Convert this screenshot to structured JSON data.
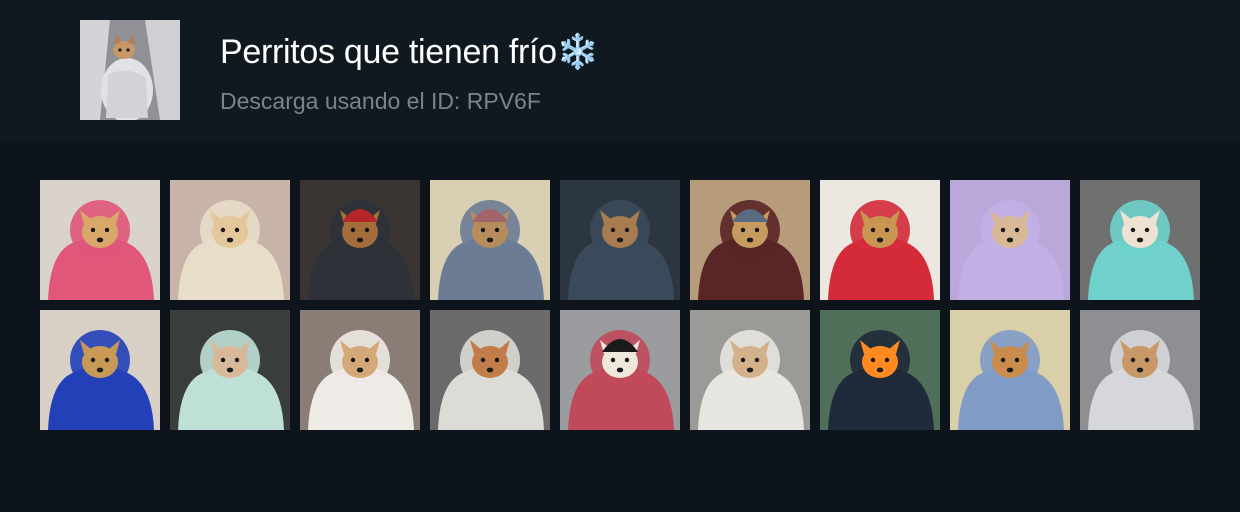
{
  "pack": {
    "title": "Perritos que tienen frío❄️",
    "subtitle": "Descarga usando el ID: RPV6F",
    "thumbnail": {
      "subject": "small dog wrapped in white blanket",
      "bg": "#8f9196",
      "blanket": "#d7d8dc",
      "dog": "#c99868"
    }
  },
  "stickers": [
    {
      "name": "sticker-puppy-sleeping-pink-blanket",
      "bg": "#d9d3cc",
      "blanket": "#e0577a",
      "dog": "#d9a76a",
      "hat": null
    },
    {
      "name": "sticker-puppy-cream-hoodie",
      "bg": "#c8b3a8",
      "blanket": "#e8ddc8",
      "dog": "#e4c79b",
      "hat": null
    },
    {
      "name": "sticker-dog-red-beanie-sunglasses",
      "bg": "#3a3532",
      "blanket": "#2e3238",
      "dog": "#a36e3c",
      "hat": "#b5262a"
    },
    {
      "name": "sticker-dog-blue-hoodie-couch",
      "bg": "#d9cfb2",
      "blanket": "#6d7c95",
      "dog": "#b58d5c",
      "hat": "#a4656a"
    },
    {
      "name": "sticker-chihuahua-dark-hood-closeup",
      "bg": "#2c3640",
      "blanket": "#3a4a5a",
      "dog": "#a87b50",
      "hat": null
    },
    {
      "name": "sticker-dog-maroon-sweater-beanie",
      "bg": "#b79c7c",
      "blanket": "#5a2525",
      "dog": "#c79a60",
      "hat": "#5a6a80"
    },
    {
      "name": "sticker-dog-red-puffer-jacket",
      "bg": "#ece8e0",
      "blanket": "#d42a3a",
      "dog": "#c89552",
      "hat": null
    },
    {
      "name": "sticker-chihuahua-lilac-blanket",
      "bg": "#b9a8d9",
      "blanket": "#c2afe4",
      "dog": "#d8b896",
      "hat": null
    },
    {
      "name": "sticker-chihuahua-teal-blanket",
      "bg": "#6f7070",
      "blanket": "#6fd0cc",
      "dog": "#efe2d2",
      "hat": null
    },
    {
      "name": "sticker-dog-blue-hoodie",
      "bg": "#d8cfc6",
      "blanket": "#2440b8",
      "dog": "#c99a55",
      "hat": null
    },
    {
      "name": "sticker-dog-mint-blanket-car",
      "bg": "#3a3d3e",
      "blanket": "#bfe0d6",
      "dog": "#d7b99a",
      "hat": null
    },
    {
      "name": "sticker-chihuahua-white-towel",
      "bg": "#8a7d75",
      "blanket": "#eeeae6",
      "dog": "#d4a878",
      "hat": null
    },
    {
      "name": "sticker-dog-grey-blanket-couch",
      "bg": "#6a6a6a",
      "blanket": "#dcdcd6",
      "dog": "#c27c4a",
      "hat": null
    },
    {
      "name": "sticker-chihuahua-headphones",
      "bg": "#9a9c9f",
      "blanket": "#c04a5a",
      "dog": "#efe6dc",
      "hat": "#1a1a1a"
    },
    {
      "name": "sticker-puppy-white-fur-blanket",
      "bg": "#9a9a96",
      "blanket": "#e7e5e0",
      "dog": "#d3b18a",
      "hat": null
    },
    {
      "name": "sticker-dog-campfire-mountains",
      "bg": "#4f6f58",
      "blanket": "#1f2a3a",
      "dog": "#ff8a22",
      "hat": null
    },
    {
      "name": "sticker-puppy-plaid-blanket",
      "bg": "#d9cfa8",
      "blanket": "#7f9bc6",
      "dog": "#c98c4c",
      "hat": null
    },
    {
      "name": "sticker-dog-white-blanket-bed",
      "bg": "#8d8f93",
      "blanket": "#d6d7db",
      "dog": "#c99868",
      "hat": null
    }
  ]
}
